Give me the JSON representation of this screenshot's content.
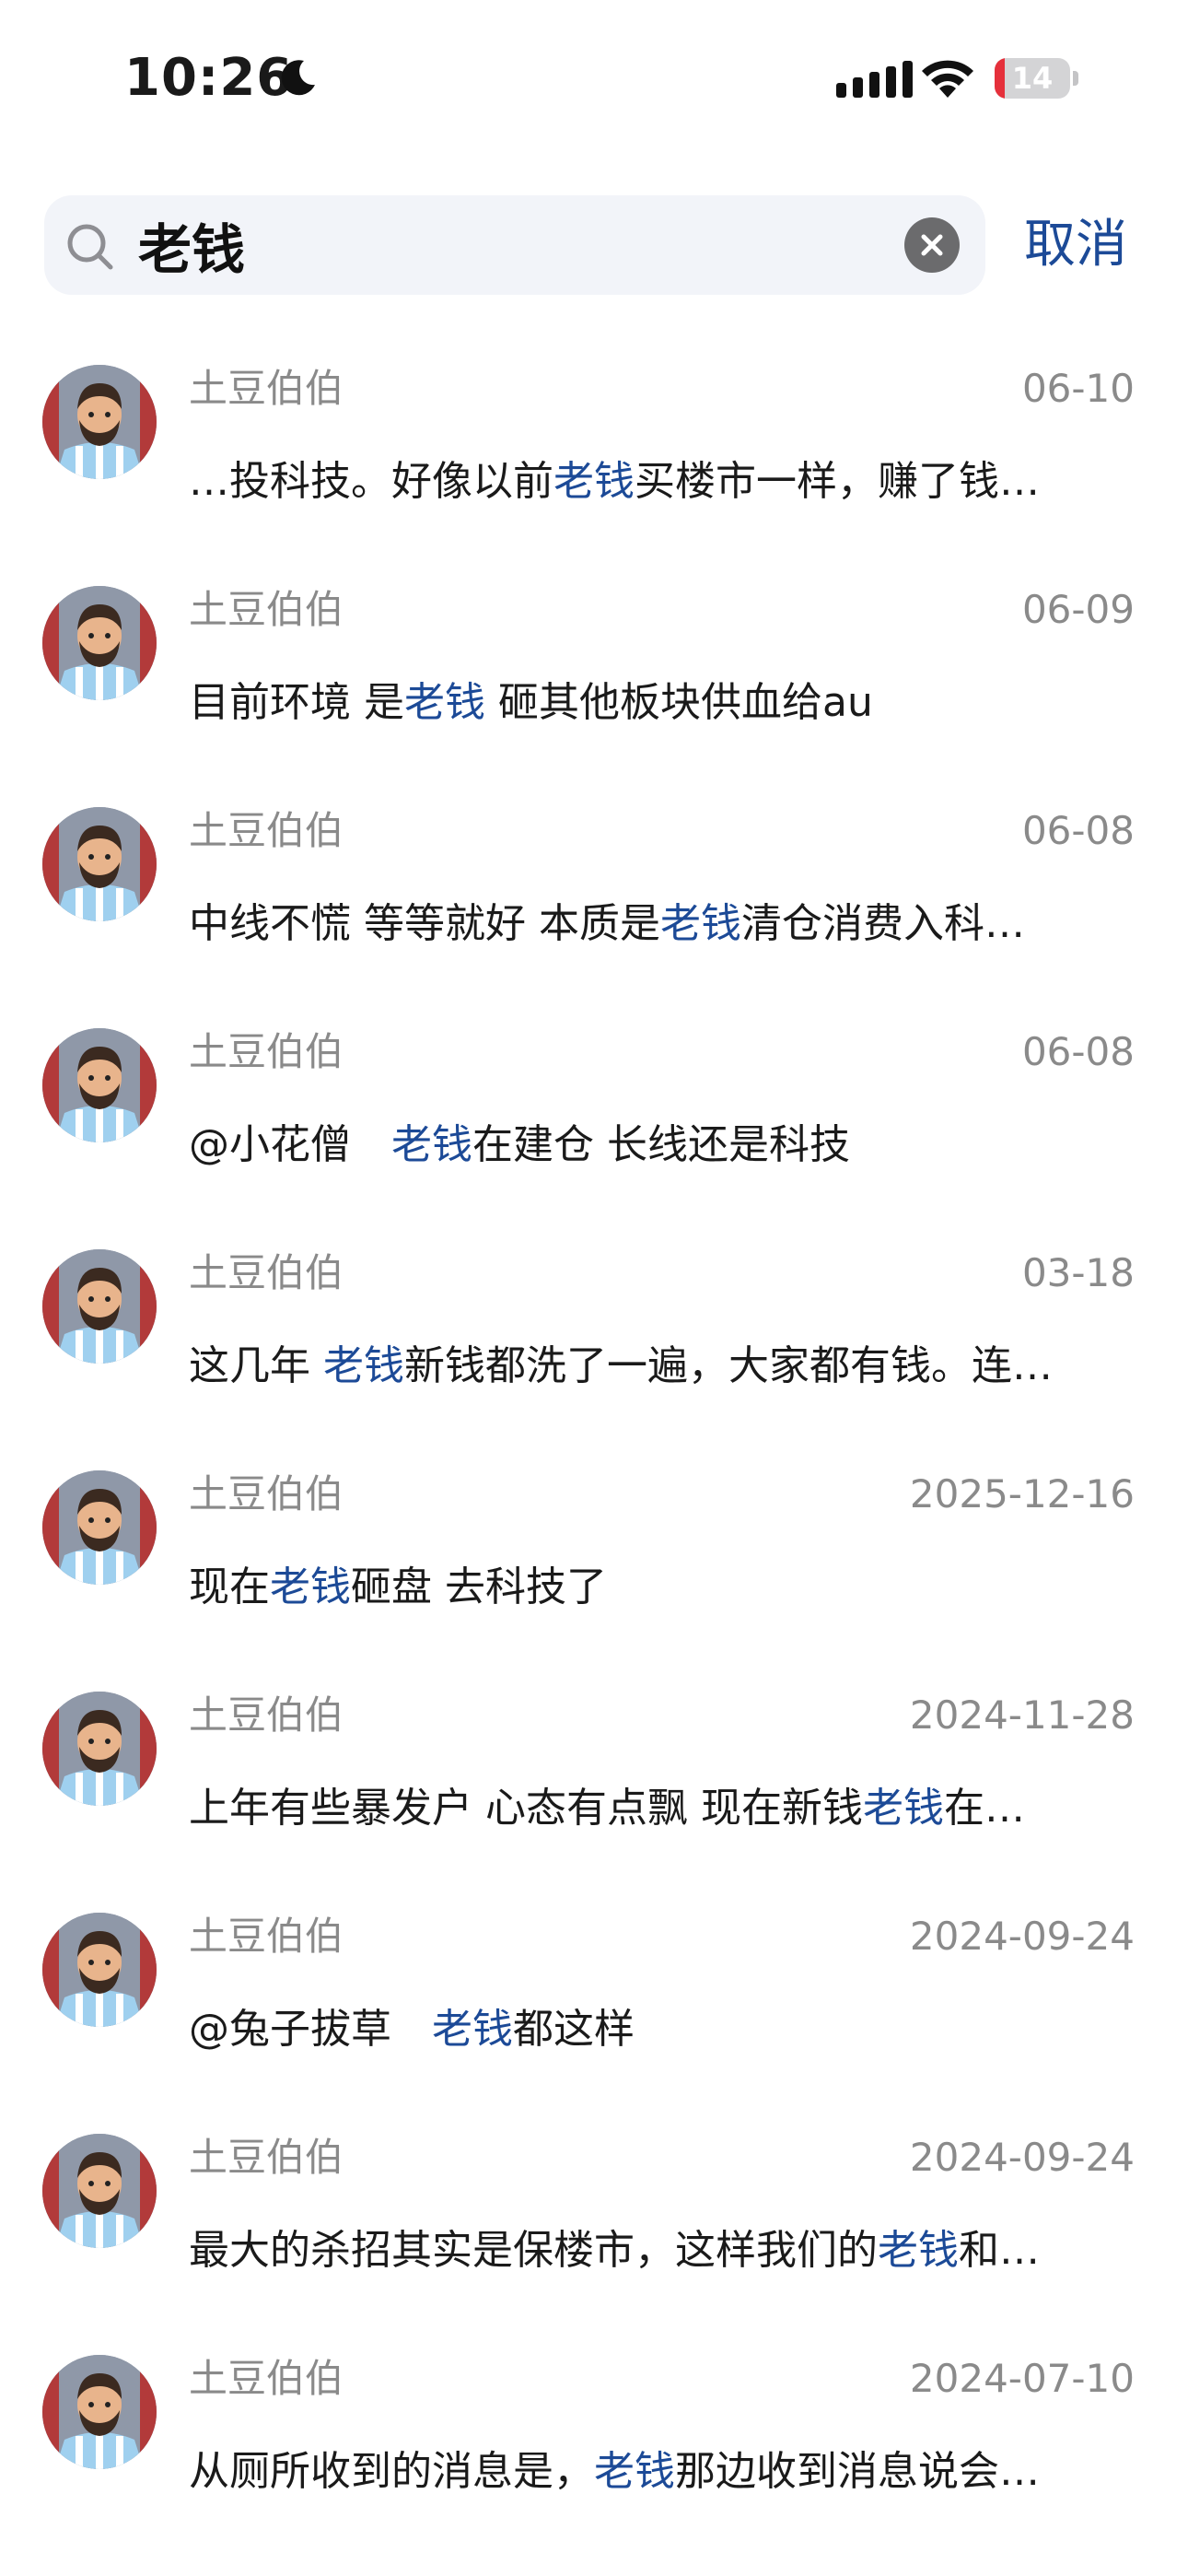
{
  "status_bar": {
    "time": "10:26",
    "battery_level": "14",
    "battery_color": "#e5303b"
  },
  "search": {
    "query": "老钱",
    "cancel_label": "取消"
  },
  "accent_color": "#1c4a97",
  "results": [
    {
      "user": "土豆伯伯",
      "date": "06-10",
      "pre": "…投科技。好像以前",
      "hl": "老钱",
      "post": "买楼市一样，赚了钱…"
    },
    {
      "user": "土豆伯伯",
      "date": "06-09",
      "pre": "目前环境 是",
      "hl": "老钱",
      "post": " 砸其他板块供血给au"
    },
    {
      "user": "土豆伯伯",
      "date": "06-08",
      "pre": "中线不慌 等等就好 本质是",
      "hl": "老钱",
      "post": "清仓消费入科…"
    },
    {
      "user": "土豆伯伯",
      "date": "06-08",
      "pre": "@小花僧　",
      "hl": "老钱",
      "post": "在建仓 长线还是科技"
    },
    {
      "user": "土豆伯伯",
      "date": "03-18",
      "pre": "这几年 ",
      "hl": "老钱",
      "post": "新钱都洗了一遍，大家都有钱。连…"
    },
    {
      "user": "土豆伯伯",
      "date": "2025-12-16",
      "pre": "现在",
      "hl": "老钱",
      "post": "砸盘 去科技了"
    },
    {
      "user": "土豆伯伯",
      "date": "2024-11-28",
      "pre": "上年有些暴发户 心态有点飘 现在新钱",
      "hl": "老钱",
      "post": "在…"
    },
    {
      "user": "土豆伯伯",
      "date": "2024-09-24",
      "pre": "@兔子拔草　",
      "hl": "老钱",
      "post": "都这样"
    },
    {
      "user": "土豆伯伯",
      "date": "2024-09-24",
      "pre": "最大的杀招其实是保楼市，这样我们的",
      "hl": "老钱",
      "post": "和…"
    },
    {
      "user": "土豆伯伯",
      "date": "2024-07-10",
      "pre": "从厕所收到的消息是，",
      "hl": "老钱",
      "post": "那边收到消息说会…"
    }
  ]
}
